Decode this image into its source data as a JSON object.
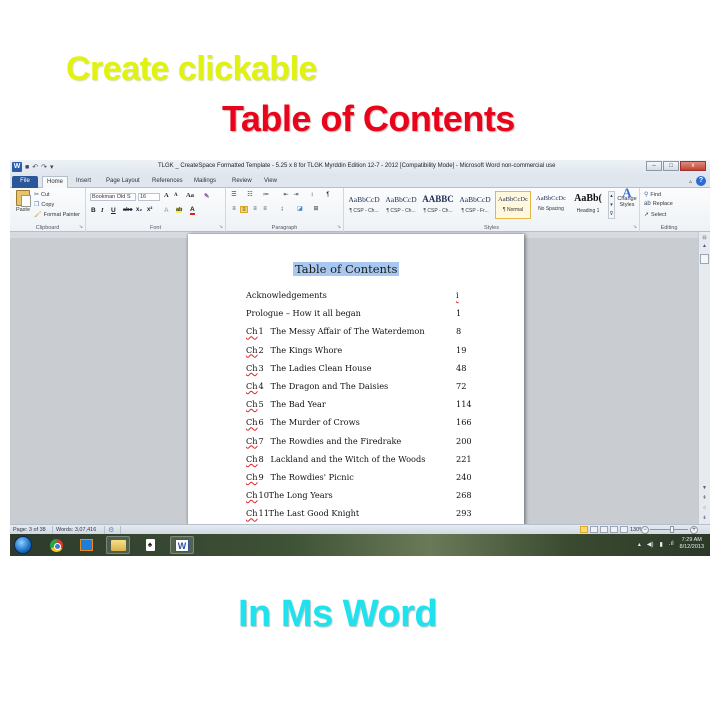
{
  "headlines": {
    "line1": "Create clickable",
    "line2": "Table of Contents",
    "line3": "In Ms Word",
    "colors": {
      "line1": "#e0f20f",
      "line2": "#e8051b",
      "line3": "#1ee2ee"
    }
  },
  "window": {
    "title": "TLGK _ CreateSpace Formatted Template - 5.25 x 8 for TLGK Myrddin Edition 12-7 - 2012 [Compatibility Mode] - Microsoft Word non-commercial use",
    "app_icon": "W",
    "quick_access": [
      "save-icon",
      "undo-icon",
      "redo-icon",
      "customize-icon"
    ],
    "controls": {
      "minimize": "–",
      "maximize": "□",
      "close": "x"
    }
  },
  "ribbon_tabs": [
    "File",
    "Home",
    "Insert",
    "Page Layout",
    "References",
    "Mailings",
    "Review",
    "View"
  ],
  "active_tab": "Home",
  "clipboard": {
    "label": "Clipboard",
    "paste": "Paste",
    "cut": "Cut",
    "copy": "Copy",
    "format_painter": "Format Painter"
  },
  "font": {
    "label": "Font",
    "family": "Bookman Old S",
    "size": "16",
    "buttons": [
      "B",
      "I",
      "U",
      "abc",
      "x₂",
      "x²"
    ],
    "grow": "A",
    "shrink": "A",
    "change_case": "Aa",
    "highlight": "ab",
    "font_color": "A"
  },
  "paragraph": {
    "label": "Paragraph",
    "align_active": "center",
    "pilcrow": "¶"
  },
  "styles": {
    "label": "Styles",
    "items": [
      {
        "sample": "AaBbCcD",
        "name": "¶ CSP - Ch..."
      },
      {
        "sample": "AaBbCcD",
        "name": "¶ CSP - Ch..."
      },
      {
        "sample": "AABBC",
        "name": "¶ CSP - Ch..."
      },
      {
        "sample": "AaBbCcD",
        "name": "¶ CSP - Fr..."
      },
      {
        "sample": "AaBbCcDc",
        "name": "¶ Normal"
      },
      {
        "sample": "AaBbCcDc",
        "name": "No Spacing"
      },
      {
        "sample": "AaBb(",
        "name": "Heading 1"
      }
    ],
    "selected": "¶ Normal",
    "change_styles": "Change Styles"
  },
  "editing": {
    "label": "Editing",
    "find": "Find",
    "replace": "Replace",
    "select": "Select"
  },
  "document": {
    "toc_title": "Table of Contents",
    "entries": [
      {
        "prefix": "",
        "text": "Acknowledgements",
        "page": "i"
      },
      {
        "prefix": "",
        "text": "Prologue – How it all began",
        "page": "1"
      },
      {
        "prefix": "Ch",
        "num": "1",
        "text": "The Messy Affair of The Waterdemon",
        "page": "8"
      },
      {
        "prefix": "Ch",
        "num": "2",
        "text": "The Kings Whore",
        "page": "19"
      },
      {
        "prefix": "Ch",
        "num": "3",
        "text": "The Ladies Clean House",
        "page": "48"
      },
      {
        "prefix": "Ch",
        "num": "4",
        "text": "The Dragon and The Daisies",
        "page": "72"
      },
      {
        "prefix": "Ch",
        "num": "5",
        "text": "The Bad Year",
        "page": "114"
      },
      {
        "prefix": "Ch",
        "num": "6",
        "text": "The Murder of Crows",
        "page": "166"
      },
      {
        "prefix": "Ch",
        "num": "7",
        "text": "The Rowdies and the Firedrake",
        "page": "200"
      },
      {
        "prefix": "Ch",
        "num": "8",
        "text": "Lackland and the Witch of the Woods",
        "page": "221"
      },
      {
        "prefix": "Ch",
        "num": "9",
        "text": "The Rowdies' Picnic",
        "page": "240"
      },
      {
        "prefix": "Ch",
        "num": "10",
        "text": "The Long Years",
        "page": "268"
      },
      {
        "prefix": "Ch",
        "num": "11",
        "text": "The Last Good Knight",
        "page": "293"
      }
    ]
  },
  "statusbar": {
    "page": "Page: 3 of 38",
    "words": "Words: 3,07,416",
    "zoom": "130%",
    "zoom_out": "−",
    "zoom_in": "+"
  },
  "taskbar": {
    "apps": [
      "start-orb",
      "chrome",
      "media-player",
      "file-explorer",
      "solitaire",
      "word"
    ],
    "time": "7:29 AM",
    "date": "8/12/2013"
  }
}
